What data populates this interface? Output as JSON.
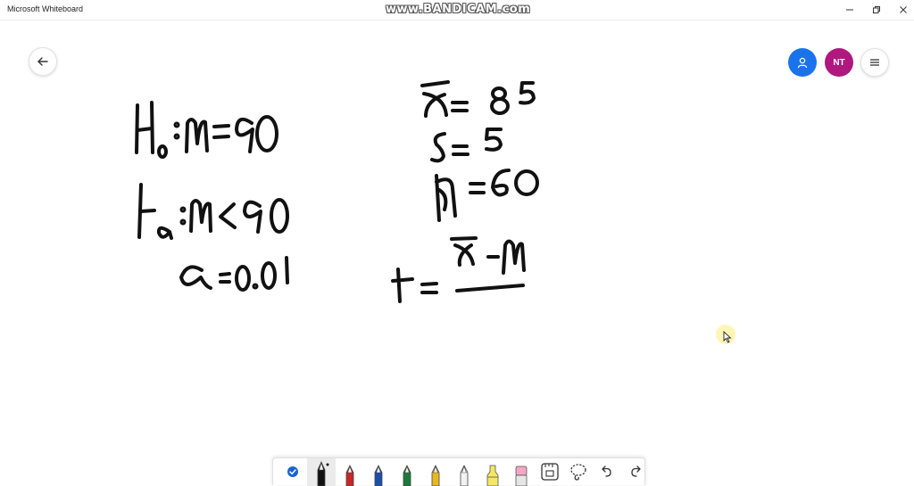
{
  "window": {
    "title": "Microsoft Whiteboard",
    "watermark": "www.BANDICAM.com"
  },
  "header": {
    "avatar_initials": "NT"
  },
  "colors": {
    "share_button": "#1a73e8",
    "avatar": "#b0177f",
    "ink": "#111111",
    "toolbar_check": "#1565d8"
  },
  "icons": {
    "back": "arrow-left-icon",
    "share": "person-icon",
    "menu": "hamburger-menu-icon",
    "minimize": "minimize-icon",
    "restore": "restore-icon",
    "close": "close-icon"
  },
  "toolbar": {
    "tools": [
      {
        "name": "select-tool",
        "icon": "check-circle-icon"
      },
      {
        "name": "pen-black",
        "icon": "pen-icon",
        "color": "#111111",
        "selected": true
      },
      {
        "name": "pen-red",
        "icon": "pen-icon",
        "color": "#c62828"
      },
      {
        "name": "pen-blue",
        "icon": "pen-icon",
        "color": "#1e4fa8"
      },
      {
        "name": "pen-green",
        "icon": "pen-icon",
        "color": "#1b7a3a"
      },
      {
        "name": "pen-yellow",
        "icon": "pen-icon",
        "color": "#e8b820"
      },
      {
        "name": "pen-white",
        "icon": "pen-icon",
        "color": "#f2f2f2"
      },
      {
        "name": "highlighter",
        "icon": "highlighter-icon",
        "color": "#f5e663"
      },
      {
        "name": "eraser",
        "icon": "eraser-icon",
        "color": "#f4a6c6"
      },
      {
        "name": "ruler",
        "icon": "ruler-icon"
      },
      {
        "name": "lasso",
        "icon": "lasso-icon"
      },
      {
        "name": "undo",
        "icon": "undo-icon"
      },
      {
        "name": "redo",
        "icon": "redo-icon"
      }
    ]
  }
}
